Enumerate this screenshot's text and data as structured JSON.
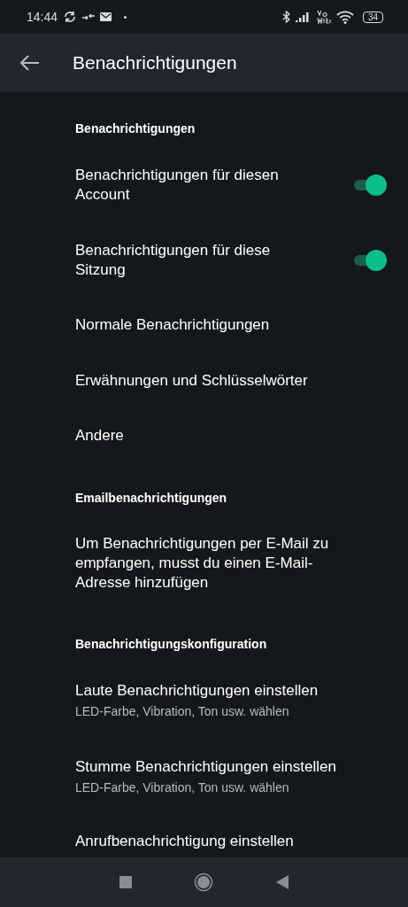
{
  "status_bar": {
    "time": "14:44",
    "battery": "34"
  },
  "app_bar": {
    "title": "Benachrichtigungen"
  },
  "items": [
    {
      "kind": "header",
      "title": "Benachrichtigungen"
    },
    {
      "kind": "toggle",
      "title": "Benachrichtigungen für diesen Account",
      "on": true
    },
    {
      "kind": "toggle",
      "title": "Benachrichtigungen für diese Sitzung",
      "on": true
    },
    {
      "kind": "link",
      "title": "Normale Benachrichtigungen"
    },
    {
      "kind": "link",
      "title": "Erwähnungen und Schlüsselwörter"
    },
    {
      "kind": "link",
      "title": "Andere"
    },
    {
      "kind": "header",
      "title": "Emailbenachrichtigungen"
    },
    {
      "kind": "info",
      "title": "Um Benachrichtigungen per E-Mail zu empfangen, musst du einen E-Mail-Adresse hinzufügen"
    },
    {
      "kind": "header",
      "title": "Benachrichtigungskonfiguration"
    },
    {
      "kind": "detail",
      "title": "Laute Benachrichtigungen einstellen",
      "subtitle": "LED-Farbe, Vibration, Ton usw. wählen"
    },
    {
      "kind": "detail",
      "title": "Stumme Benachrichtigungen einstellen",
      "subtitle": "LED-Farbe, Vibration, Ton usw. wählen"
    },
    {
      "kind": "detail",
      "title": "Anrufbenachrichtigung einstellen"
    }
  ]
}
